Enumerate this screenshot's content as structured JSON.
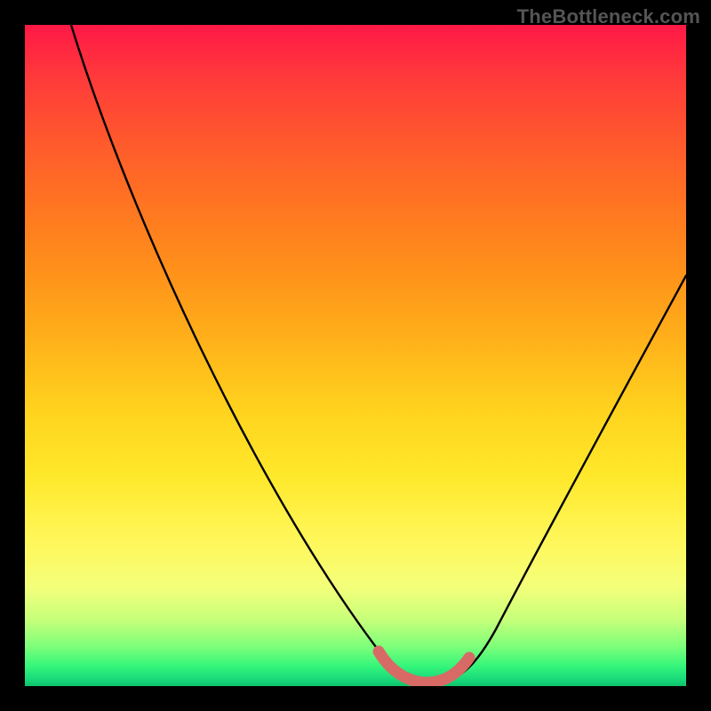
{
  "watermark": "TheBottleneck.com",
  "chart_data": {
    "type": "line",
    "title": "",
    "xlabel": "",
    "ylabel": "",
    "xlim": [
      0,
      100
    ],
    "ylim": [
      0,
      100
    ],
    "series": [
      {
        "name": "black-curve",
        "color": "#000000",
        "x": [
          7,
          10,
          15,
          20,
          25,
          30,
          35,
          40,
          45,
          50,
          55,
          60,
          63,
          65,
          70,
          75,
          80,
          85,
          90,
          95,
          100
        ],
        "y": [
          100,
          94,
          84,
          74,
          64,
          54,
          44,
          34,
          24,
          14,
          6,
          2,
          0.5,
          1,
          5,
          12,
          21,
          31,
          42,
          52,
          62
        ]
      },
      {
        "name": "salmon-base-segment",
        "color": "#d86a66",
        "x": [
          55,
          57,
          59,
          61,
          63,
          65,
          67
        ],
        "y": [
          3,
          1.5,
          0.8,
          0.5,
          0.6,
          1.2,
          2.5
        ]
      }
    ],
    "gradient_stops": [
      {
        "pos": 0,
        "color": "#ff1846"
      },
      {
        "pos": 50,
        "color": "#ffd21e"
      },
      {
        "pos": 90,
        "color": "#c6ff7a"
      },
      {
        "pos": 100,
        "color": "#0dc26a"
      }
    ]
  }
}
